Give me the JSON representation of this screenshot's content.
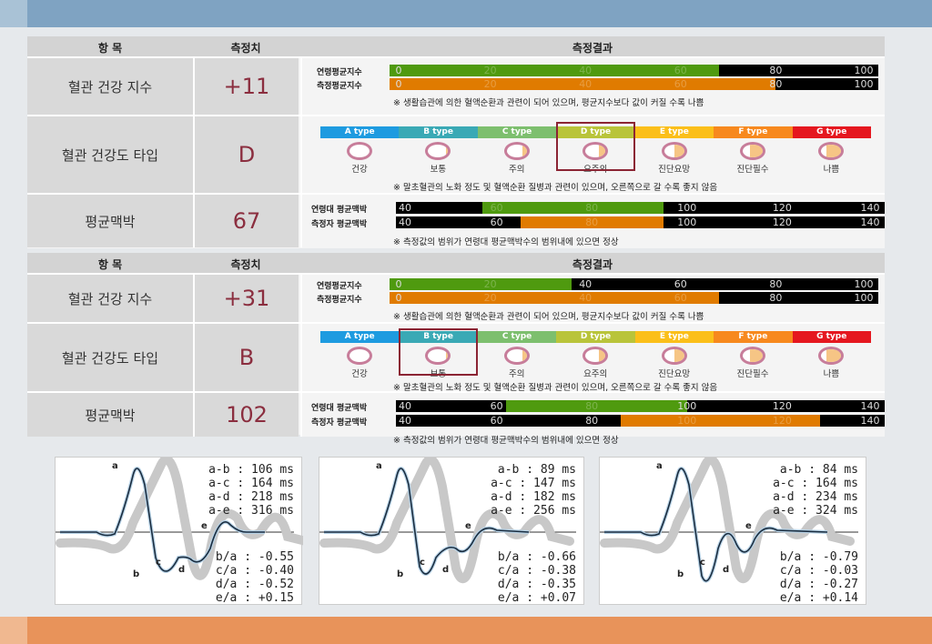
{
  "header": {
    "item": "항 목",
    "value": "측정치",
    "result": "측정결과"
  },
  "labels": {
    "index_row": "혈관 건강 지수",
    "type_row": "혈관 건강도 타입",
    "pulse_row": "평균맥박",
    "avg_index": "연령평균지수",
    "meas_index": "측정평균지수",
    "avg_pulse": "연령대 평균맥박",
    "meas_pulse": "측정자 평균맥박"
  },
  "notes": {
    "index": "※  생활습관에 의한 혈액순환과 관련이 되어 있으며, 평균지수보다 값이 커질 수록 나쁨",
    "type": "※  말초혈관의 노화 정도 및 혈액순환 질병과 관련이 있으며, 오른쪽으로 갈 수록 좋지 않음",
    "pulse": "※  측정값의 범위가 연령대 평균맥박수의 범위내에 있으면 정상"
  },
  "index_ticks": [
    "0",
    "20",
    "40",
    "60",
    "80",
    "100"
  ],
  "pulse_ticks": [
    "40",
    "60",
    "80",
    "100",
    "120",
    "140"
  ],
  "types": [
    {
      "name": "A type",
      "label": "건강",
      "color": "#1e9be0",
      "plaque": 0
    },
    {
      "name": "B type",
      "label": "보통",
      "color": "#3aa9b5",
      "plaque": 0.12
    },
    {
      "name": "C type",
      "label": "주의",
      "color": "#7dbf6e",
      "plaque": 0.2
    },
    {
      "name": "D type",
      "label": "요주의",
      "color": "#b9c43a",
      "plaque": 0.35
    },
    {
      "name": "E type",
      "label": "진단요망",
      "color": "#fbbf1a",
      "plaque": 0.5
    },
    {
      "name": "F type",
      "label": "진단필수",
      "color": "#f7891e",
      "plaque": 0.65
    },
    {
      "name": "G type",
      "label": "나쁨",
      "color": "#e5171f",
      "plaque": 0.75
    }
  ],
  "colors": {
    "avg": "#4f9a0f",
    "meas": "#e07b00"
  },
  "blocks": [
    {
      "index_value": "+11",
      "avg_index": 68,
      "meas_index": 80,
      "type_value": "D",
      "selected_type": 3,
      "pulse_value": "67",
      "avg_pulse": [
        57,
        95
      ],
      "meas_pulse": [
        65,
        95
      ]
    },
    {
      "index_value": "+31",
      "avg_index": 37,
      "meas_index": 68,
      "type_value": "B",
      "selected_type": 1,
      "pulse_value": "102",
      "avg_pulse": [
        62,
        100
      ],
      "meas_pulse": [
        86,
        128
      ]
    }
  ],
  "waves": [
    {
      "times": [
        "a-b : 106 ms",
        "a-c : 164 ms",
        "a-d : 218 ms",
        "a-e : 316 ms"
      ],
      "ratios": [
        "b/a : -0.55",
        "c/a : -0.40",
        "d/a : -0.52",
        "e/a : +0.15"
      ]
    },
    {
      "times": [
        "a-b :  89 ms",
        "a-c : 147 ms",
        "a-d : 182 ms",
        "a-e : 256 ms"
      ],
      "ratios": [
        "b/a : -0.66",
        "c/a : -0.38",
        "d/a : -0.35",
        "e/a : +0.07"
      ]
    },
    {
      "times": [
        "a-b :  84 ms",
        "a-c : 164 ms",
        "a-d : 234 ms",
        "a-e : 324 ms"
      ],
      "ratios": [
        "b/a : -0.79",
        "c/a : -0.03",
        "d/a : -0.27",
        "e/a : +0.14"
      ]
    }
  ],
  "peak_labels": [
    "a",
    "b",
    "c",
    "d",
    "e"
  ]
}
